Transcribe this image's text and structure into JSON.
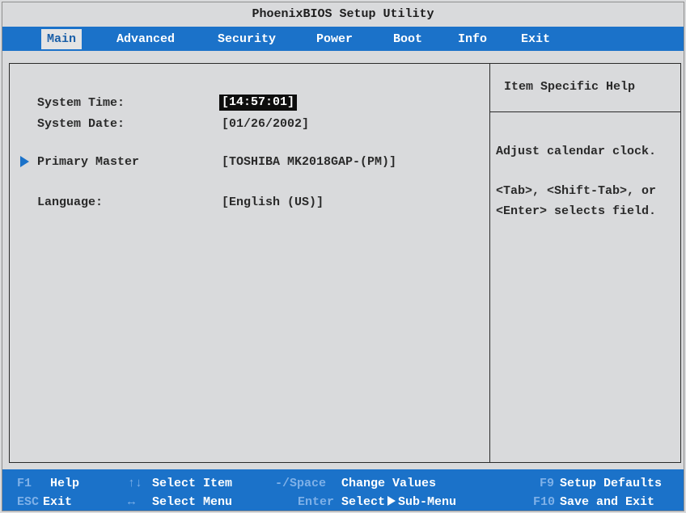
{
  "title": "PhoenixBIOS Setup Utility",
  "menu": [
    {
      "label": "Main",
      "active": true
    },
    {
      "label": "Advanced",
      "active": false
    },
    {
      "label": "Security",
      "active": false
    },
    {
      "label": "Power",
      "active": false
    },
    {
      "label": "Boot",
      "active": false
    },
    {
      "label": "Info",
      "active": false
    },
    {
      "label": "Exit",
      "active": false
    }
  ],
  "settings": {
    "system_time": {
      "label": "System Time:",
      "value": "[14:57:01]"
    },
    "system_date": {
      "label": "System Date:",
      "value": "[01/26/2002]"
    },
    "primary_master": {
      "label": "Primary Master",
      "value": "[TOSHIBA MK2018GAP-(PM)]",
      "icon": "submenu-arrow-icon"
    },
    "language": {
      "label": "Language:",
      "value": "[English (US)]"
    }
  },
  "help": {
    "title": "Item Specific Help",
    "line1": "Adjust calendar clock.",
    "line2": "<Tab>, <Shift-Tab>, or",
    "line3": "<Enter> selects field."
  },
  "status": {
    "f1_key": "F1",
    "f1_desc": "Help",
    "esc_key": "ESC",
    "esc_desc": "Exit",
    "updown_key": "↑↓",
    "updown_desc": "Select Item",
    "leftright_key": "↔",
    "leftright_desc": "Select Menu",
    "space_key": "-/Space",
    "space_desc": "Change Values",
    "enter_key": "Enter",
    "enter_desc_a": "Select",
    "enter_desc_b": "Sub-Menu",
    "f9_key": "F9",
    "f9_desc": "Setup Defaults",
    "f10_key": "F10",
    "f10_desc": "Save and Exit"
  },
  "colors": {
    "menu_bar": "#1b72c9",
    "background": "#d9dadc",
    "selected_value_bg": "#0d0d0d",
    "key_hint": "#7fb1e8"
  }
}
